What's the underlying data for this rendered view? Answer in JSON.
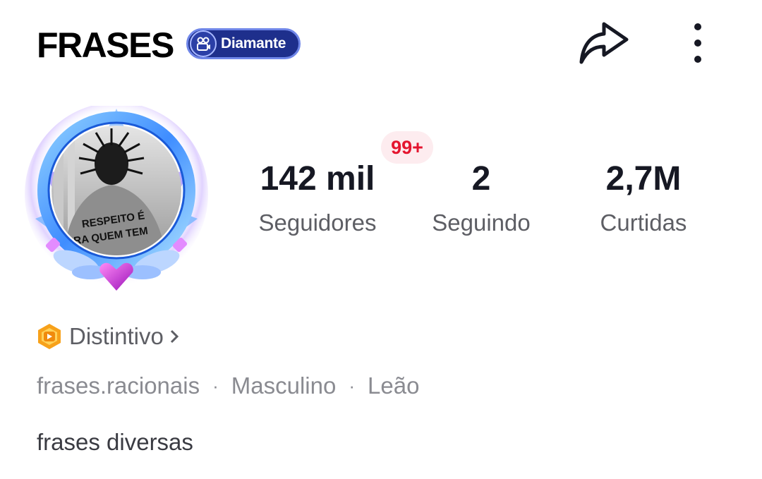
{
  "header": {
    "title": "FRASES",
    "badge_label": "Diamante",
    "badge_icon": "video-camera-icon",
    "share_icon": "share-arrow-icon",
    "more_icon": "more-vertical-icon"
  },
  "avatar": {
    "shirt_text_line1": "RESPEITO É",
    "shirt_text_line2": "RA QUEM TEM",
    "frame_colors": {
      "ring": "#4fa3ff",
      "glow": "#c9a6ff",
      "gem": "#d43bd6"
    }
  },
  "notification_badge": "99+",
  "stats": [
    {
      "value": "142 mil",
      "label": "Seguidores"
    },
    {
      "value": "2",
      "label": "Seguindo"
    },
    {
      "value": "2,7M",
      "label": "Curtidas"
    }
  ],
  "distintivo": {
    "label": "Distintivo",
    "icon": "badge-hexagon-icon"
  },
  "info": {
    "username": "frases.racionais",
    "gender": "Masculino",
    "sign": "Leão",
    "separator": "·"
  },
  "bio": "frases diversas",
  "colors": {
    "accent_badge": "#1e2f8c",
    "notif_red": "#e4152f",
    "text_primary": "#161823",
    "text_secondary": "#5d5e64"
  }
}
